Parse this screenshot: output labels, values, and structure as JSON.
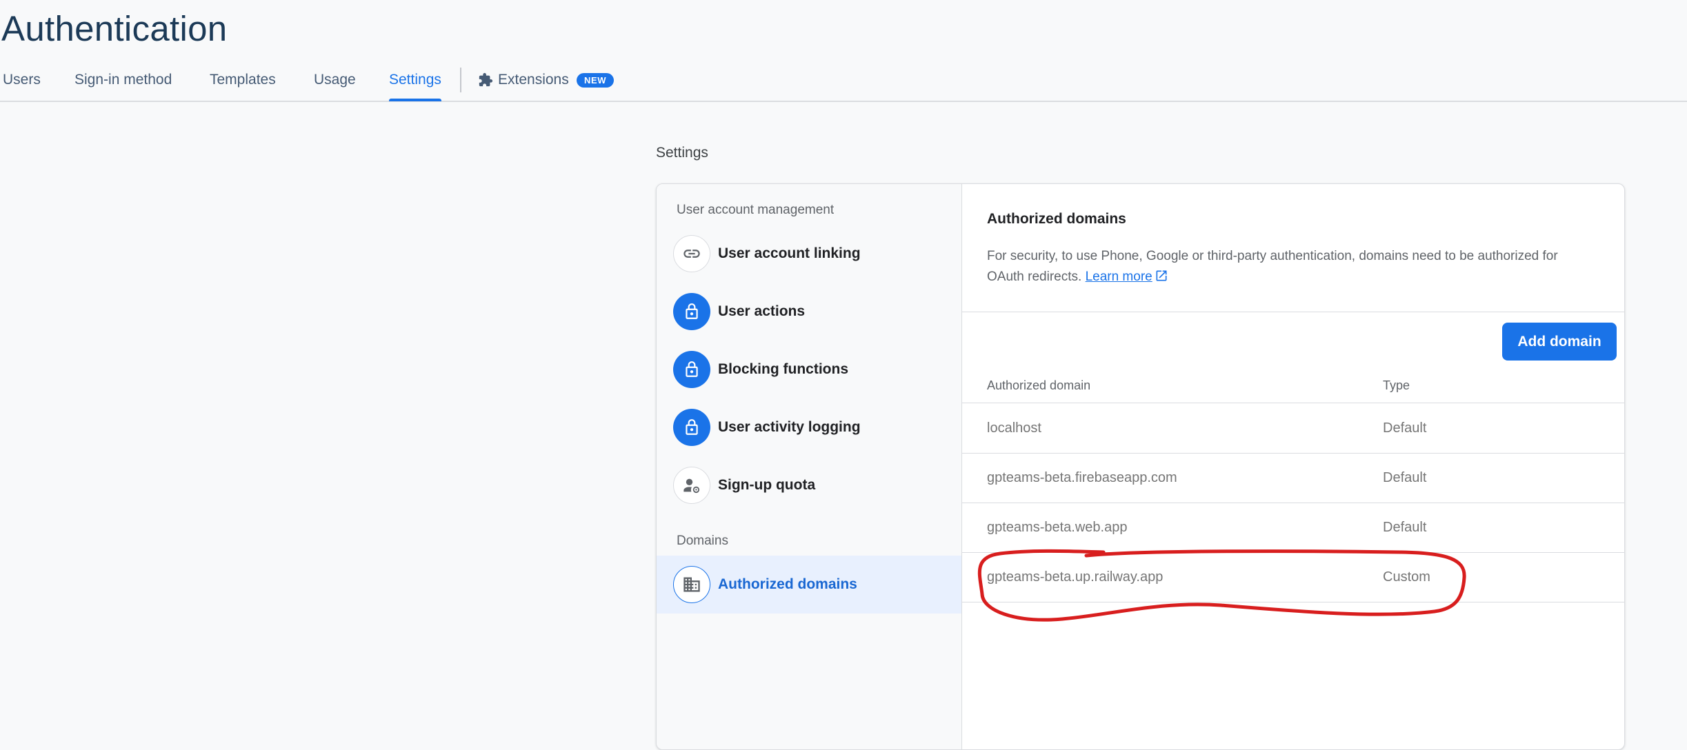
{
  "page": {
    "title": "Authentication"
  },
  "tabs": [
    {
      "label": "Users"
    },
    {
      "label": "Sign-in method"
    },
    {
      "label": "Templates"
    },
    {
      "label": "Usage"
    },
    {
      "label": "Settings",
      "active": true
    }
  ],
  "extensions_tab": {
    "label": "Extensions",
    "badge": "NEW",
    "icon": "extension-puzzle-icon"
  },
  "settings": {
    "section_title": "Settings",
    "nav": {
      "group1_label": "User account management",
      "group2_label": "Domains",
      "items": [
        {
          "label": "User account linking",
          "icon": "link-icon"
        },
        {
          "label": "User actions",
          "icon": "lock-icon"
        },
        {
          "label": "Blocking functions",
          "icon": "lock-icon"
        },
        {
          "label": "User activity logging",
          "icon": "lock-icon"
        },
        {
          "label": "Sign-up quota",
          "icon": "person-settings-icon"
        },
        {
          "label": "Authorized domains",
          "icon": "building-icon",
          "selected": true
        }
      ]
    },
    "detail": {
      "title": "Authorized domains",
      "description": "For security, to use Phone, Google or third-party authentication, domains need to be authorized for OAuth redirects.",
      "learn_more": "Learn more",
      "add_button": "Add domain",
      "table": {
        "headers": [
          "Authorized domain",
          "Type"
        ],
        "rows": [
          {
            "domain": "localhost",
            "type": "Default"
          },
          {
            "domain": "gpteams-beta.firebaseapp.com",
            "type": "Default"
          },
          {
            "domain": "gpteams-beta.web.app",
            "type": "Default"
          },
          {
            "domain": "gpteams-beta.up.railway.app",
            "type": "Custom"
          }
        ]
      }
    }
  },
  "colors": {
    "accent": "#1a73e8",
    "title": "#1c3a57",
    "annotation": "#d81e1e",
    "selected_bg": "#e8f0fe"
  }
}
